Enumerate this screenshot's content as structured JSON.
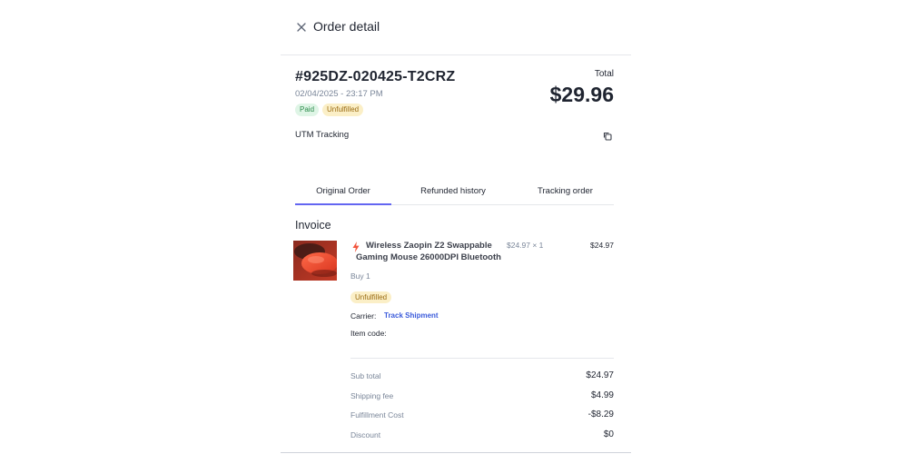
{
  "header": {
    "title": "Order detail"
  },
  "order": {
    "id": "#925DZ-020425-T2CRZ",
    "date": "02/04/2025 - 23:17 PM",
    "badges": {
      "paid": "Paid",
      "fulfillment": "Unfulfilled"
    },
    "total_label": "Total",
    "total_value": "$29.96",
    "utm_label": "UTM Tracking"
  },
  "tabs": [
    {
      "label": "Original Order"
    },
    {
      "label": "Refunded history"
    },
    {
      "label": "Tracking order"
    }
  ],
  "invoice": {
    "title": "Invoice",
    "item": {
      "name": "Wireless Zaopin Z2 Swappable Gaming Mouse 26000DPI Bluetooth",
      "unit_price": "$24.97 × 1",
      "line_total": "$24.97",
      "qty_text": "Buy 1",
      "status": "Unfulfilled",
      "carrier_label": "Carrier:",
      "track_link": "Track Shipment",
      "item_code_label": "Item code:"
    },
    "summary": [
      {
        "label": "Sub total",
        "value": "$24.97"
      },
      {
        "label": "Shipping fee",
        "value": "$4.99"
      },
      {
        "label": "Fulfillment Cost",
        "value": "-$8.29"
      },
      {
        "label": "Discount",
        "value": "$0"
      }
    ]
  },
  "colors": {
    "accent": "#6366f1",
    "link": "#3b5bdb",
    "paid_bg": "#dff5e6",
    "unfulfilled_bg": "#fbefc7",
    "bolt": "#f2553d"
  },
  "icons": [
    "close-icon",
    "copy-icon",
    "bolt-icon"
  ]
}
